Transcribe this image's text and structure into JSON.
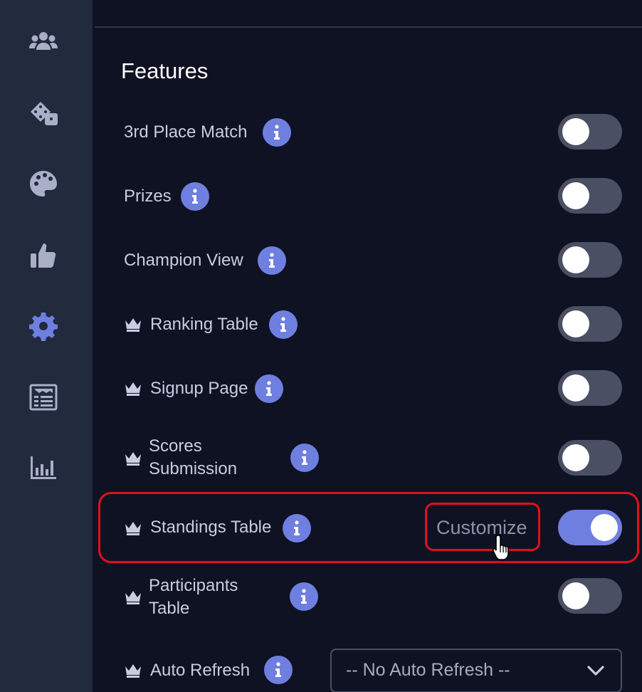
{
  "sidebar": {
    "icons": [
      "users-icon",
      "dice-icon",
      "palette-icon",
      "thumbs-up-icon",
      "gear-icon",
      "newspaper-icon",
      "bar-chart-icon"
    ],
    "active": "gear-icon",
    "icon_color": "#a8afc6",
    "active_color": "#6f7fe0"
  },
  "main": {
    "section_title": "Features",
    "features": [
      {
        "label": "3rd Place Match",
        "premium": false,
        "enabled": false
      },
      {
        "label": "Prizes",
        "premium": false,
        "enabled": false
      },
      {
        "label": "Champion View",
        "premium": false,
        "enabled": false
      },
      {
        "label": "Ranking Table",
        "premium": true,
        "enabled": false
      },
      {
        "label": "Signup Page",
        "premium": true,
        "enabled": false
      },
      {
        "label_line1": "Scores",
        "label_line2": "Submission",
        "premium": true,
        "enabled": false
      },
      {
        "label": "Standings Table",
        "premium": true,
        "enabled": true,
        "action": "Customize"
      },
      {
        "label_line1": "Participants",
        "label_line2": "Table",
        "premium": true,
        "enabled": false
      },
      {
        "label": "Auto Refresh",
        "premium": true,
        "select_value": "-- No Auto Refresh --"
      }
    ]
  },
  "colors": {
    "accent": "#6f7fe0",
    "highlight": "#e0101a",
    "background": "#0e1223",
    "sidebar": "#222a3d"
  }
}
